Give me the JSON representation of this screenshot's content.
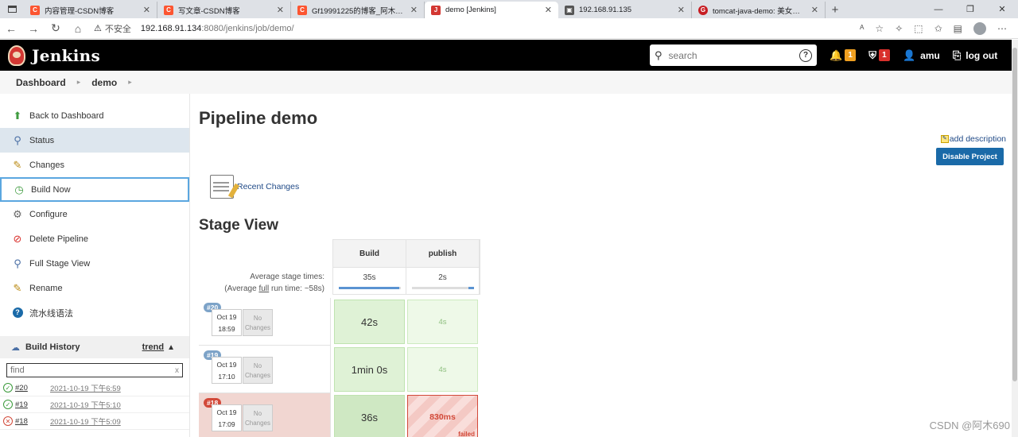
{
  "browser": {
    "tabs": [
      {
        "title": "内容管理-CSDN博客",
        "fav": "C",
        "color": "#fc5531"
      },
      {
        "title": "写文章-CSDN博客",
        "fav": "C",
        "color": "#fc5531"
      },
      {
        "title": "Gf19991225的博客_阿木690_CSD",
        "fav": "C",
        "color": "#fc5531"
      },
      {
        "title": "demo [Jenkins]",
        "fav": "J",
        "color": "#d33833"
      },
      {
        "title": "192.168.91.135",
        "fav": "▣",
        "color": "#555555"
      },
      {
        "title": "tomcat-java-demo: 美女示例（Ja",
        "fav": "G",
        "color": "#c71d23"
      }
    ],
    "insecure_label": "不安全",
    "url_host": "192.168.91.134",
    "url_path": ":8080/jenkins/job/demo/"
  },
  "header": {
    "logo_text": "Jenkins",
    "search_placeholder": "search",
    "notifications_count": "1",
    "security_count": "1",
    "user": "amu",
    "logout": "log out"
  },
  "breadcrumb": {
    "dashboard": "Dashboard",
    "job": "demo"
  },
  "sidebar": {
    "tasks": [
      {
        "label": "Back to Dashboard",
        "icon": "arrow-up-icon"
      },
      {
        "label": "Status",
        "icon": "magnifier-icon"
      },
      {
        "label": "Changes",
        "icon": "notepad-icon"
      },
      {
        "label": "Build Now",
        "icon": "clock-play-icon"
      },
      {
        "label": "Configure",
        "icon": "gear-icon"
      },
      {
        "label": "Delete Pipeline",
        "icon": "no-entry-icon"
      },
      {
        "label": "Full Stage View",
        "icon": "magnifier-icon"
      },
      {
        "label": "Rename",
        "icon": "notepad-icon"
      },
      {
        "label": "流水线语法",
        "icon": "help-icon"
      }
    ],
    "build_history": {
      "title": "Build History",
      "trend": "trend",
      "find_placeholder": "find",
      "clear": "x",
      "builds": [
        {
          "num": "#20",
          "date": "2021-10-19 下午6:59",
          "status": "success"
        },
        {
          "num": "#19",
          "date": "2021-10-19 下午5:10",
          "status": "success"
        },
        {
          "num": "#18",
          "date": "2021-10-19 下午5:09",
          "status": "failed"
        }
      ]
    }
  },
  "main": {
    "title": "Pipeline demo",
    "add_description": "add description",
    "disable_project": "Disable Project",
    "recent_changes": "Recent Changes",
    "stage_view_title": "Stage View",
    "stages": [
      "Build",
      "publish"
    ],
    "avg_label_1": "Average stage times:",
    "avg_label_2a": "(Average ",
    "avg_label_2b": "full",
    "avg_label_2c": " run time: ~58s)",
    "avg_times": [
      "35s",
      "2s"
    ],
    "avg_bar_fraction": [
      0.98,
      0.08
    ],
    "runs": [
      {
        "tag": "#20",
        "month_day": "Oct 19",
        "time": "18:59",
        "changes": "No Changes",
        "build": "42s",
        "publish": "4s",
        "failed": false
      },
      {
        "tag": "#19",
        "month_day": "Oct 19",
        "time": "17:10",
        "changes": "No Changes",
        "build": "1min 0s",
        "publish": "4s",
        "failed": false
      },
      {
        "tag": "#18",
        "month_day": "Oct 19",
        "time": "17:09",
        "changes": "No Changes",
        "build": "36s",
        "publish": "830ms",
        "failed": true,
        "failed_label": "failed"
      }
    ]
  },
  "watermark": "CSDN @阿木690"
}
